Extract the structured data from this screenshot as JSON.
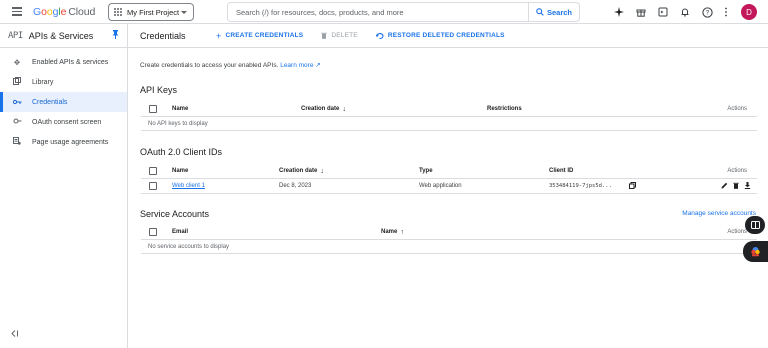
{
  "header": {
    "logo": "Google Cloud",
    "project": "My First Project",
    "search_placeholder": "Search (/) for resources, docs, products, and more",
    "search_button": "Search",
    "avatar_letter": "D"
  },
  "sidebar": {
    "api_logo": "API",
    "title": "APIs & Services",
    "items": [
      {
        "label": "Enabled APIs & services",
        "icon": "diamond-nodes-icon"
      },
      {
        "label": "Library",
        "icon": "library-icon"
      },
      {
        "label": "Credentials",
        "icon": "key-icon",
        "active": true
      },
      {
        "label": "OAuth consent screen",
        "icon": "oauth-icon"
      },
      {
        "label": "Page usage agreements",
        "icon": "agreements-icon"
      }
    ]
  },
  "toolbar": {
    "title": "Credentials",
    "create": "CREATE CREDENTIALS",
    "delete": "DELETE",
    "restore": "RESTORE DELETED CREDENTIALS"
  },
  "main": {
    "intro": "Create credentials to access your enabled APIs.",
    "learn_more": "Learn more",
    "api_keys": {
      "title": "API Keys",
      "columns": {
        "name": "Name",
        "creation_date": "Creation date",
        "restrictions": "Restrictions",
        "actions": "Actions"
      },
      "empty": "No API keys to display"
    },
    "oauth": {
      "title": "OAuth 2.0 Client IDs",
      "columns": {
        "name": "Name",
        "creation_date": "Creation date",
        "type": "Type",
        "client_id": "Client ID",
        "actions": "Actions"
      },
      "rows": [
        {
          "name": "Web client 1",
          "creation_date": "Dec 8, 2023",
          "type": "Web application",
          "client_id": "353484119-7jps5d..."
        }
      ]
    },
    "service_accounts": {
      "title": "Service Accounts",
      "manage": "Manage service accounts",
      "columns": {
        "email": "Email",
        "name": "Name",
        "actions": "Actions"
      },
      "empty": "No service accounts to display"
    }
  },
  "colors": {
    "accent": "#1a73e8",
    "active_bg": "#e8f0fe",
    "avatar": "#c2185b"
  }
}
